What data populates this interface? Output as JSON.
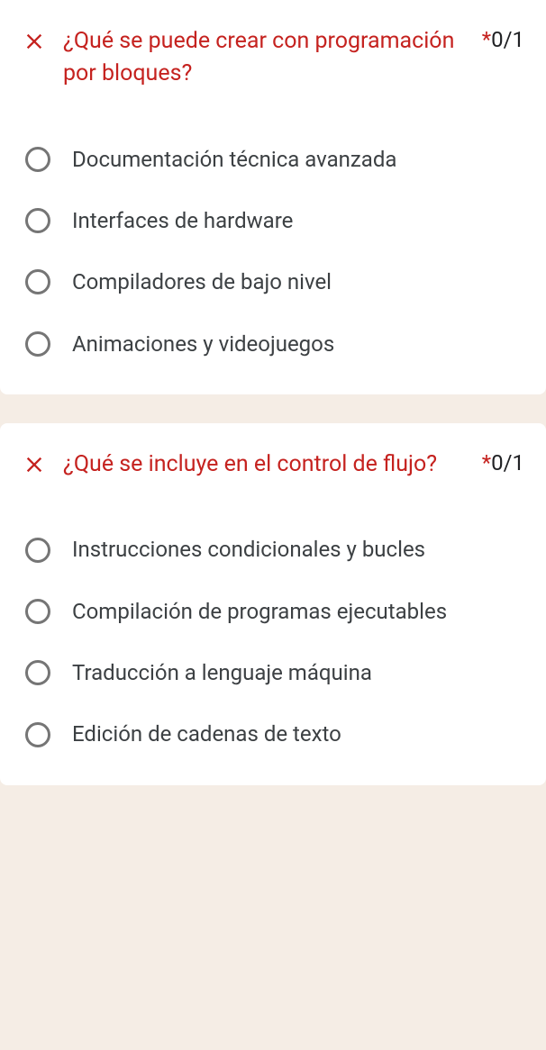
{
  "questions": [
    {
      "title": "¿Qué se puede crear con programación por bloques?",
      "score": "0/1",
      "options": [
        "Documentación técnica avanzada",
        "Interfaces de hardware",
        "Compiladores de bajo nivel",
        "Animaciones y videojuegos"
      ]
    },
    {
      "title": "¿Qué se incluye en el control de flujo?",
      "score": "0/1",
      "options": [
        "Instrucciones condicionales y bucles",
        "Compilación de programas ejecutables",
        "Traducción a lenguaje máquina",
        "Edición de cadenas de texto"
      ]
    }
  ]
}
